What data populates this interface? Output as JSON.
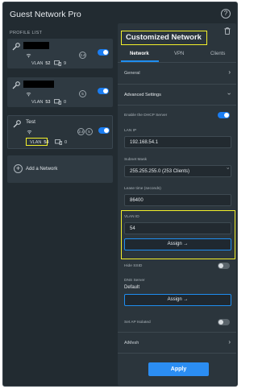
{
  "app": {
    "title": "Guest Network Pro",
    "help_icon": "help-circle-icon"
  },
  "profile_list": {
    "label": "PROFILE LIST",
    "profiles": [
      {
        "name": "",
        "name_redacted": true,
        "vlan_label": "VLAN",
        "vlan": "52",
        "clients": "9",
        "bands": [
          "2.4"
        ],
        "enabled": true
      },
      {
        "name": "",
        "name_redacted": true,
        "vlan_label": "VLAN",
        "vlan": "53",
        "clients": "0",
        "bands": [
          "5"
        ],
        "enabled": true
      },
      {
        "name": "Test",
        "name_redacted": false,
        "vlan_label": "VLAN",
        "vlan": "54",
        "clients": "0",
        "bands": [
          "2.4",
          "5"
        ],
        "enabled": true,
        "selected": true
      }
    ],
    "add_label": "Add a Network"
  },
  "panel": {
    "title": "Customized Network",
    "tabs": [
      {
        "label": "Network",
        "active": true
      },
      {
        "label": "VPN"
      },
      {
        "label": "Clients"
      }
    ],
    "general_label": "General",
    "advanced_label": "Advanced Settings",
    "dhcp": {
      "label": "Enable the DHCP Server",
      "on": true
    },
    "lan_ip": {
      "label": "LAN IP",
      "value": "192.168.54.1"
    },
    "subnet": {
      "label": "Subnet Mask",
      "value": "255.255.255.0 (253 Clients)"
    },
    "lease": {
      "label": "Lease time (seconds)",
      "value": "86400"
    },
    "vlan_id": {
      "label": "VLAN ID",
      "value": "54",
      "assign": "Assign"
    },
    "hide_ssid": {
      "label": "Hide SSID",
      "on": false
    },
    "dns": {
      "label": "DNS Server",
      "value": "Default",
      "assign": "Assign"
    },
    "ap_isolated": {
      "label": "Set AP Isolated",
      "on": false
    },
    "aimesh_label": "AiMesh",
    "apply_label": "Apply"
  },
  "colors": {
    "accent": "#1f8ef0",
    "highlight": "#f3f02a",
    "background": "#222b31"
  }
}
